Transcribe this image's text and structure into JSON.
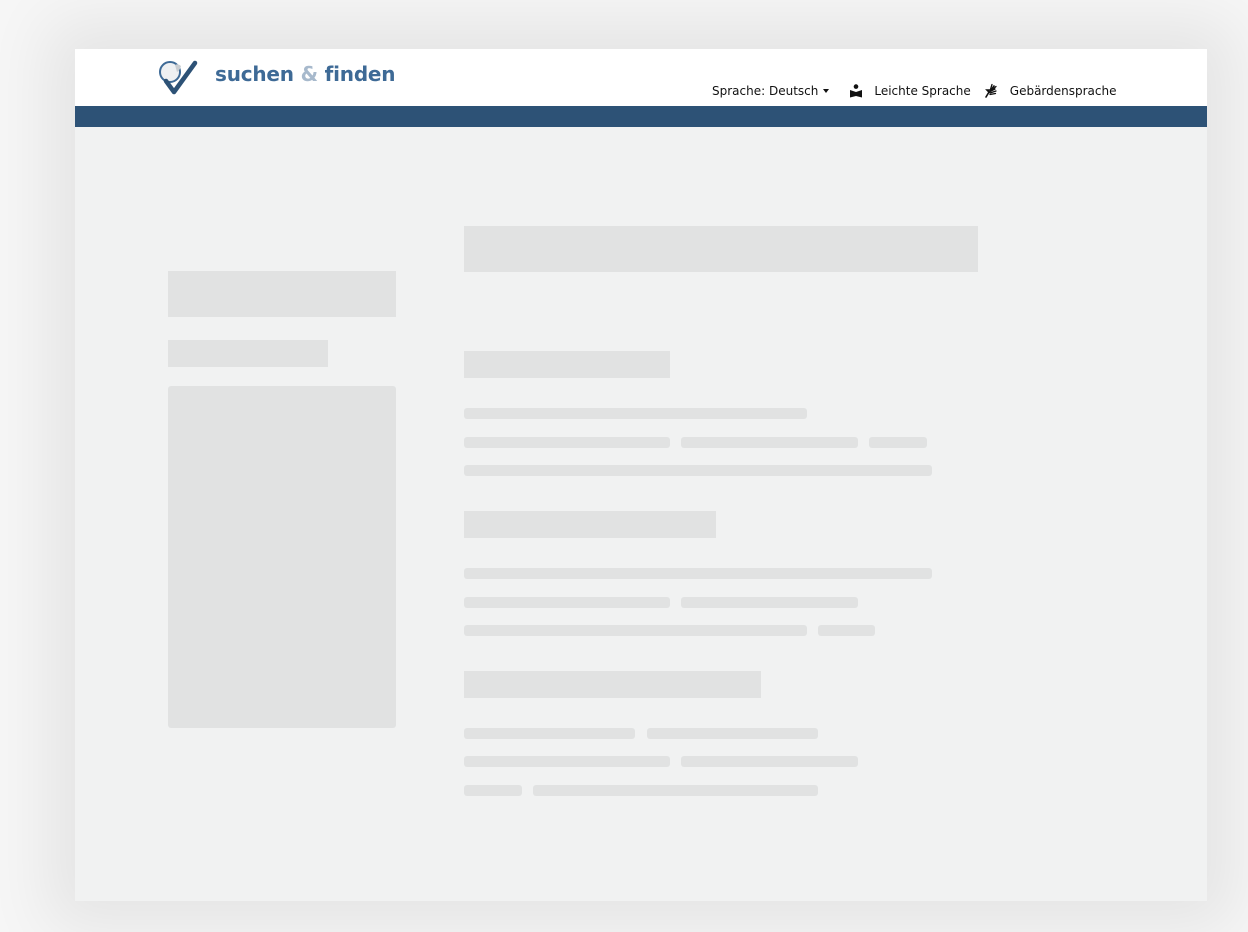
{
  "header": {
    "logo": {
      "word1": "suchen",
      "amp": "&",
      "word2": "finden",
      "icon": "magnifier-checkmark-icon"
    },
    "nav": {
      "language_label": "Sprache: Deutsch",
      "easy_language_label": "Leichte Sprache",
      "easy_language_icon": "reading-person-icon",
      "sign_language_label": "Gebärdensprache",
      "sign_language_icon": "sign-language-hands-icon"
    }
  },
  "colors": {
    "brand_blue": "#3e6a96",
    "brand_light": "#a7b9cc",
    "band": "#2d5276",
    "page_background": "#f1f2f2",
    "skeleton": "#e1e2e2"
  },
  "main": {
    "state": "loading-skeleton"
  }
}
